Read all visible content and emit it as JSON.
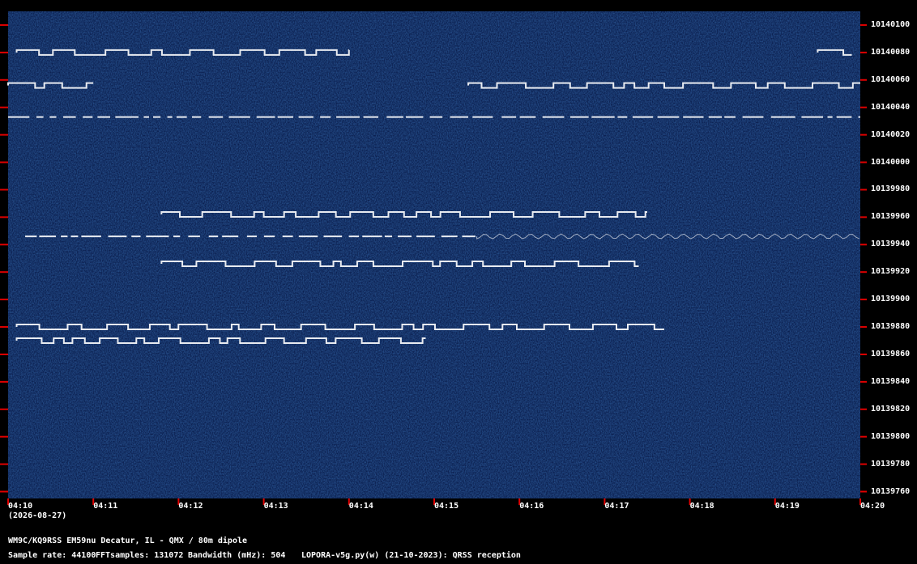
{
  "header": {
    "date": "(2026-08-27)"
  },
  "footer": {
    "station": "WM9C/KQ9RSS EM59nu Decatur, IL - QMX / 80m dipole",
    "sample_rate": "Sample rate: 44100",
    "fft_samples": "FFTsamples: 131072",
    "bandwidth": "Bandwidth (mHz): 504",
    "software": "LOPORA-v5g.py(w) (21-10-2023): QRSS reception"
  },
  "colors": {
    "background": "#0b1f4f",
    "signal": "#ffffff",
    "tick": "#e00000"
  },
  "chart_data": {
    "type": "heatmap",
    "title": "",
    "xlabel": "",
    "ylabel": "",
    "x_ticks": [
      "04:10",
      "04:11",
      "04:12",
      "04:13",
      "04:14",
      "04:15",
      "04:16",
      "04:17",
      "04:18",
      "04:19",
      "04:20"
    ],
    "y_ticks": [
      10140100,
      10140080,
      10140060,
      10140040,
      10140020,
      10140000,
      10139980,
      10139960,
      10139940,
      10139920,
      10139900,
      10139880,
      10139860,
      10139840,
      10139820,
      10139800,
      10139780,
      10139760
    ],
    "xlim": [
      "04:10",
      "04:20"
    ],
    "ylim": [
      10139755,
      10140110
    ],
    "traces": [
      {
        "freq": 10140080,
        "start": "04:10.1",
        "end": "04:14.0",
        "style": "keyed"
      },
      {
        "freq": 10140080,
        "start": "04:19.5",
        "end": "04:19.9",
        "style": "keyed"
      },
      {
        "freq": 10140056,
        "start": "04:10.0",
        "end": "04:11.0",
        "style": "keyed"
      },
      {
        "freq": 10140056,
        "start": "04:15.4",
        "end": "04:20.0",
        "style": "keyed"
      },
      {
        "freq": 10140033,
        "start": "04:10.0",
        "end": "04:20.0",
        "style": "dashed"
      },
      {
        "freq": 10139962,
        "start": "04:11.8",
        "end": "04:17.5",
        "style": "keyed"
      },
      {
        "freq": 10139946,
        "start": "04:10.2",
        "end": "04:15.5",
        "style": "dashed"
      },
      {
        "freq": 10139946,
        "start": "04:15.5",
        "end": "04:20.0",
        "style": "wavy"
      },
      {
        "freq": 10139926,
        "start": "04:11.8",
        "end": "04:17.4",
        "style": "keyed"
      },
      {
        "freq": 10139880,
        "start": "04:10.1",
        "end": "04:17.7",
        "style": "keyed"
      },
      {
        "freq": 10139870,
        "start": "04:10.1",
        "end": "04:14.9",
        "style": "keyed"
      }
    ]
  }
}
